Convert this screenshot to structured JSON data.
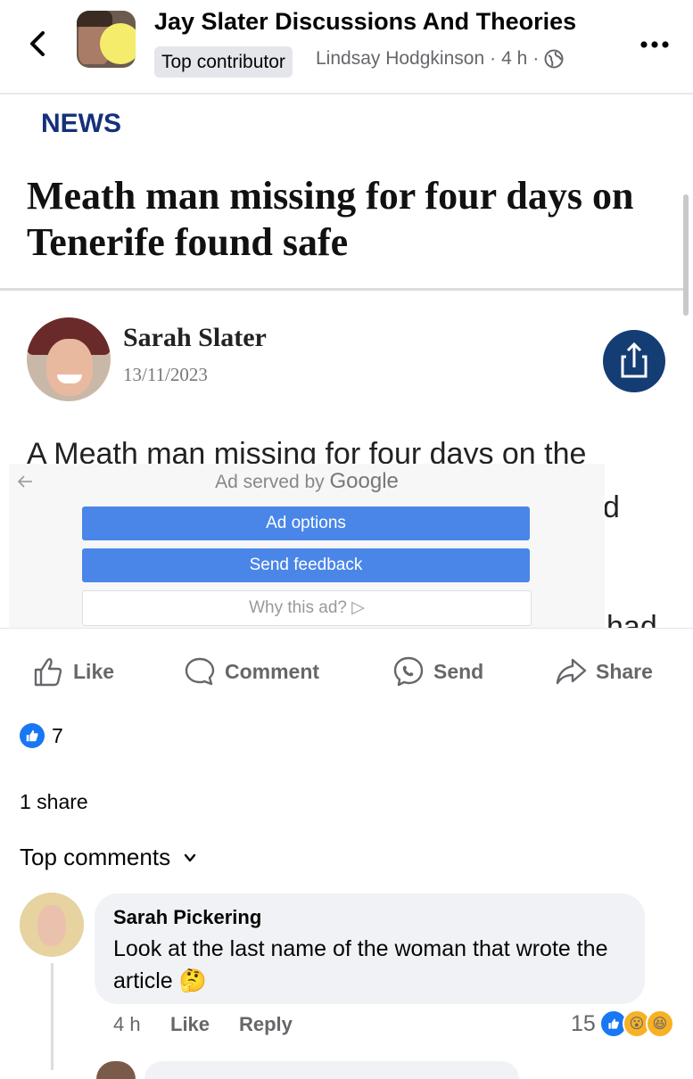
{
  "header": {
    "group_title": "Jay Slater Discussions And Theories",
    "badge": "Top contributor",
    "author": "Lindsay Hodgkinson",
    "separator": "·",
    "time": "4 h"
  },
  "article": {
    "section": "NEWS",
    "headline": "Meath man missing for four days on Tenerife found safe",
    "author_name": "Sarah Slater",
    "author_date": "13/11/2023",
    "body_text": "A Meath man missing for four days on the",
    "cut_char_1": "d",
    "cut_char_2": "had"
  },
  "ad": {
    "served_by": "Ad served by",
    "brand": "Google",
    "options_label": "Ad options",
    "feedback_label": "Send feedback",
    "why_label": "Why this ad?"
  },
  "actions": {
    "like": "Like",
    "comment": "Comment",
    "send": "Send",
    "share": "Share"
  },
  "stats": {
    "reaction_count": "7",
    "shares": "1 share",
    "top_comments": "Top comments"
  },
  "comment": {
    "name": "Sarah Pickering",
    "text": "Look at the last name of the woman that wrote the article 🤔",
    "time": "4 h",
    "like": "Like",
    "reply": "Reply",
    "reaction_count": "15"
  },
  "colors": {
    "facebook_blue": "#1877f2",
    "news_navy": "#15307a",
    "ad_blue": "#4a86e8",
    "share_circle": "#143d74"
  },
  "icons": [
    "back-icon",
    "more-icon",
    "globe-icon",
    "share-icon",
    "like-icon",
    "comment-icon",
    "messenger-icon",
    "share-arrow-icon",
    "chevron-down-icon"
  ]
}
